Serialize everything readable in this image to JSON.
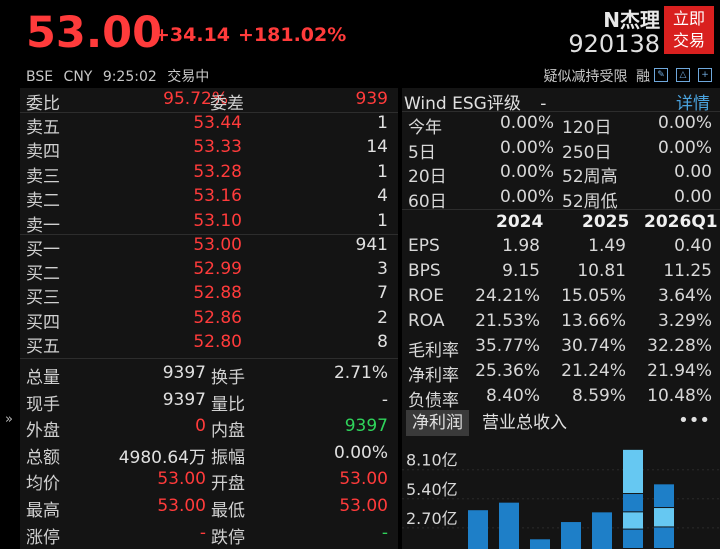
{
  "quote": {
    "price": "53.00",
    "change": "+34.14",
    "change_pct": "+181.02%",
    "name": "N杰理",
    "code": "920138",
    "trade_button": "立即交易",
    "exchange": "BSE",
    "currency": "CNY",
    "time": "9:25:02",
    "status": "交易中",
    "flag_text": "疑似减持受限",
    "margin_text": "融"
  },
  "order_book": {
    "ratio_label": "委比",
    "ratio_value": "95.72%",
    "diff_label": "委差",
    "diff_value": "939",
    "asks": [
      {
        "label": "卖五",
        "price": "53.44",
        "volume": "1"
      },
      {
        "label": "卖四",
        "price": "53.33",
        "volume": "14"
      },
      {
        "label": "卖三",
        "price": "53.28",
        "volume": "1"
      },
      {
        "label": "卖二",
        "price": "53.16",
        "volume": "4"
      },
      {
        "label": "卖一",
        "price": "53.10",
        "volume": "1"
      }
    ],
    "bids": [
      {
        "label": "买一",
        "price": "53.00",
        "volume": "941"
      },
      {
        "label": "买二",
        "price": "52.99",
        "volume": "3"
      },
      {
        "label": "买三",
        "price": "52.88",
        "volume": "7"
      },
      {
        "label": "买四",
        "price": "52.86",
        "volume": "2"
      },
      {
        "label": "买五",
        "price": "52.80",
        "volume": "8"
      }
    ]
  },
  "stats": {
    "left": [
      {
        "k": "总量",
        "v": "9397",
        "c": ""
      },
      {
        "k": "现手",
        "v": "9397",
        "c": ""
      },
      {
        "k": "外盘",
        "v": "0",
        "c": "red"
      },
      {
        "k": "总额",
        "v": "4980.64万",
        "c": ""
      },
      {
        "k": "均价",
        "v": "53.00",
        "c": "red"
      },
      {
        "k": "最高",
        "v": "53.00",
        "c": "red"
      },
      {
        "k": "涨停",
        "v": "-",
        "c": "red"
      }
    ],
    "right": [
      {
        "k": "换手",
        "v": "2.71%",
        "c": ""
      },
      {
        "k": "量比",
        "v": "-",
        "c": ""
      },
      {
        "k": "内盘",
        "v": "9397",
        "c": "green"
      },
      {
        "k": "振幅",
        "v": "0.00%",
        "c": ""
      },
      {
        "k": "开盘",
        "v": "53.00",
        "c": "red"
      },
      {
        "k": "最低",
        "v": "53.00",
        "c": "red"
      },
      {
        "k": "跌停",
        "v": "-",
        "c": "green"
      }
    ]
  },
  "esg": {
    "title": "Wind ESG评级",
    "rating": "-",
    "detail": "详情"
  },
  "returns": [
    {
      "k1": "今年",
      "v1": "0.00%",
      "k2": "120日",
      "v2": "0.00%"
    },
    {
      "k1": "5日",
      "v1": "0.00%",
      "k2": "250日",
      "v2": "0.00%"
    },
    {
      "k1": "20日",
      "v1": "0.00%",
      "k2": "52周高",
      "v2": "0.00"
    },
    {
      "k1": "60日",
      "v1": "0.00%",
      "k2": "52周低",
      "v2": "0.00"
    }
  ],
  "financials": {
    "years": [
      "2024",
      "2025",
      "2026Q1"
    ],
    "rows": [
      {
        "k": "EPS",
        "v": [
          "1.98",
          "1.49",
          "0.40"
        ]
      },
      {
        "k": "BPS",
        "v": [
          "9.15",
          "10.81",
          "11.25"
        ]
      },
      {
        "k": "ROE",
        "v": [
          "24.21%",
          "15.05%",
          "3.64%"
        ]
      },
      {
        "k": "ROA",
        "v": [
          "21.53%",
          "13.66%",
          "3.29%"
        ]
      },
      {
        "k": "毛利率",
        "v": [
          "35.77%",
          "30.74%",
          "32.28%"
        ]
      },
      {
        "k": "净利率",
        "v": [
          "25.36%",
          "21.24%",
          "21.94%"
        ]
      },
      {
        "k": "负债率",
        "v": [
          "8.40%",
          "8.59%",
          "10.48%"
        ]
      }
    ]
  },
  "chart_tabs": {
    "active": "净利润",
    "other": "营业总收入",
    "more": "•••"
  },
  "mini_chart": {
    "type": "bar",
    "y_ticks": [
      "8.10亿",
      "5.40亿",
      "2.70亿"
    ],
    "y_tick_values": [
      8.1,
      5.4,
      2.7
    ],
    "ylim": [
      0,
      9.0
    ],
    "colors": {
      "dark": "#1e7fc8",
      "light": "#66c8f2"
    },
    "bars": [
      {
        "value": 3.6,
        "stack": null
      },
      {
        "value": 4.3,
        "stack": null
      },
      {
        "value": 0.9,
        "stack": null
      },
      {
        "value": 2.5,
        "stack": null
      },
      {
        "value": 3.4,
        "stack": null
      },
      {
        "value": 9.2,
        "stack": [
          1.8,
          3.4,
          5.1,
          9.2
        ]
      },
      {
        "value": 6.0,
        "stack": [
          2.0,
          3.8,
          6.0
        ]
      }
    ]
  }
}
